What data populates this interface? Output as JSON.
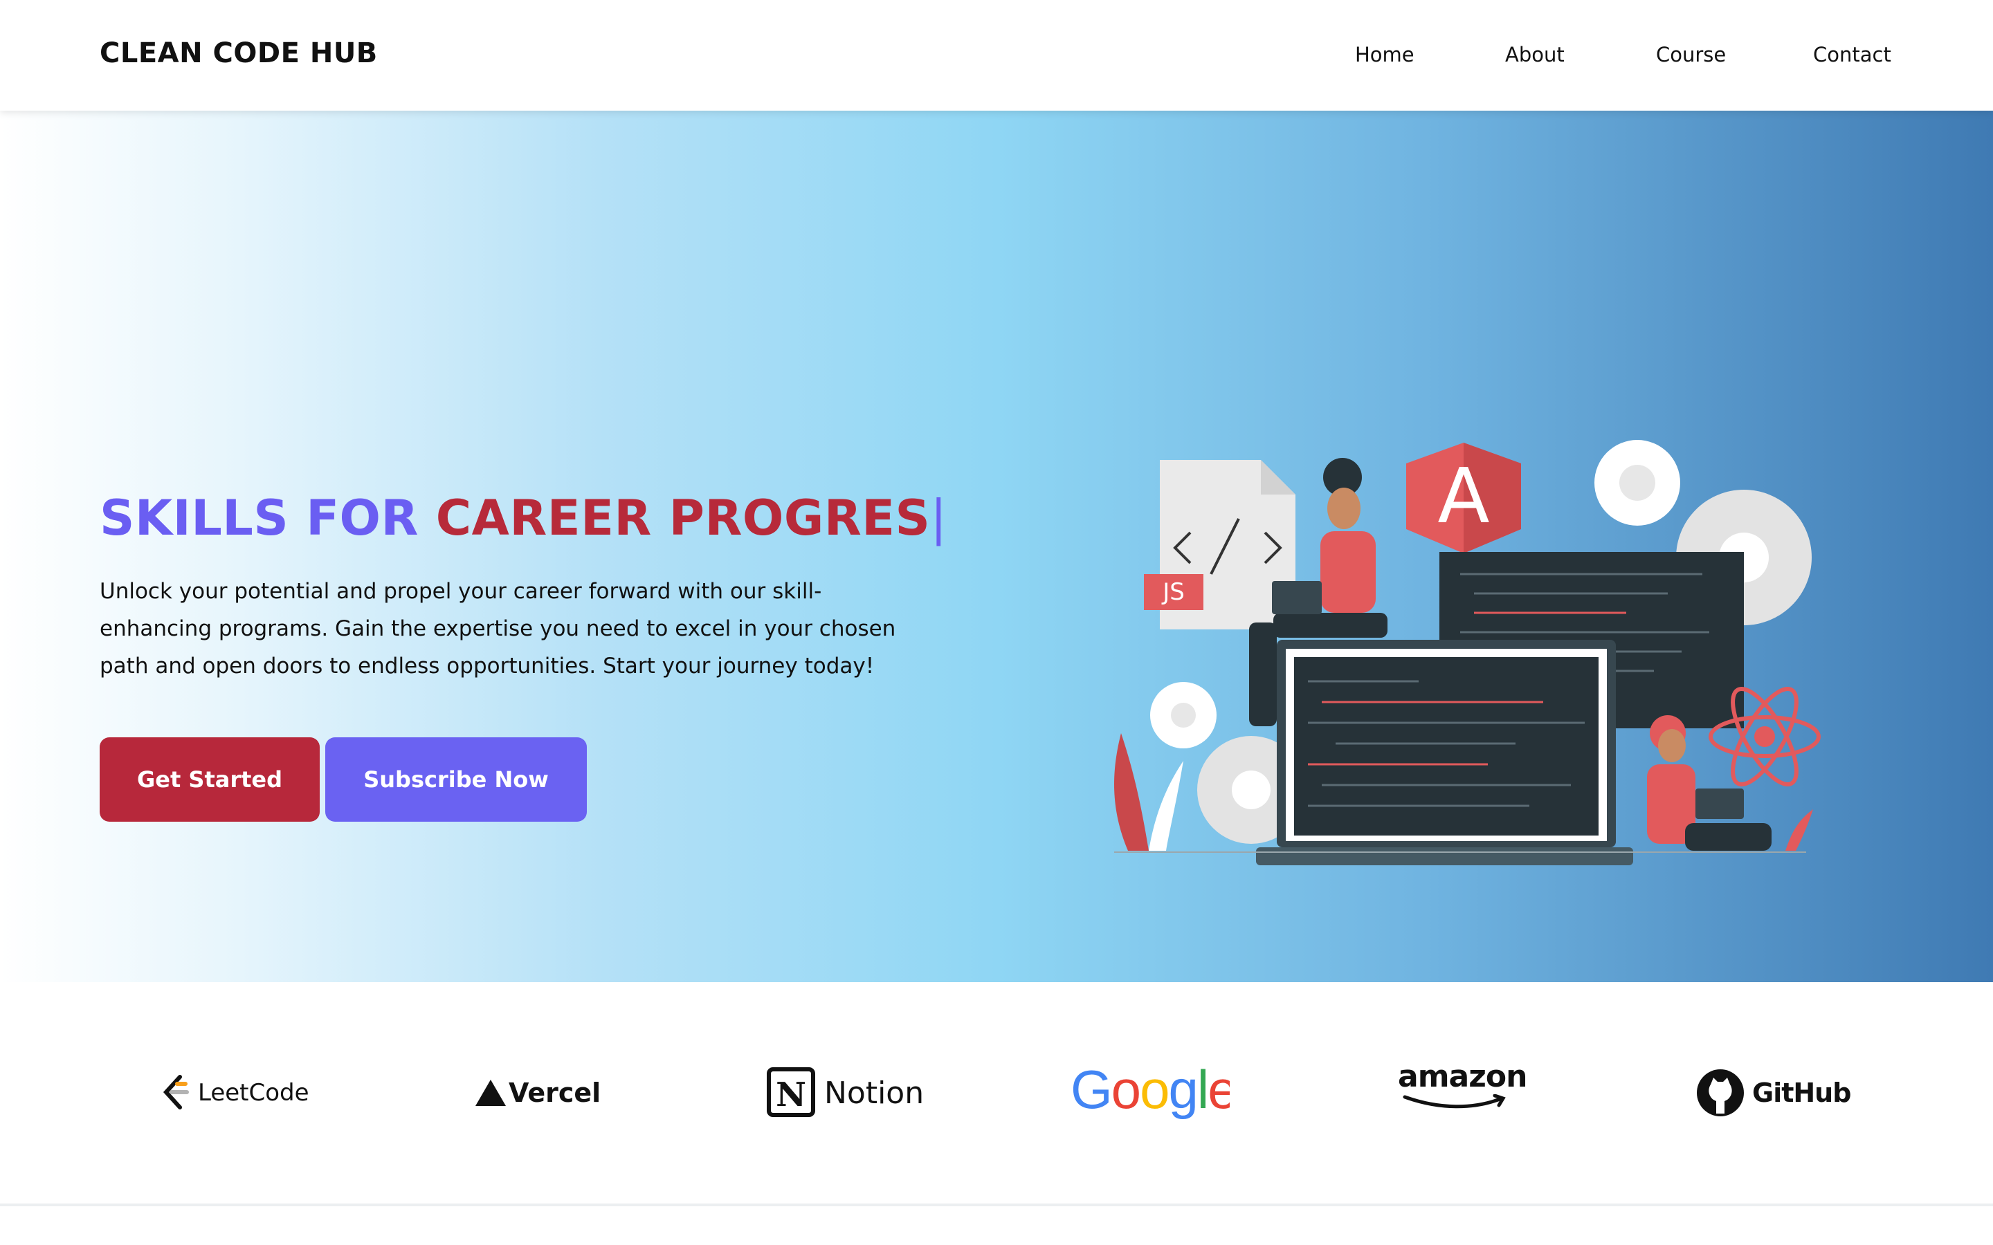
{
  "brand": {
    "name": "CLEAN CODE HUB"
  },
  "nav": {
    "items": [
      "Home",
      "About",
      "Course",
      "Contact"
    ]
  },
  "hero": {
    "headline_part1": "SKILLS FOR ",
    "headline_part2": "CAREER PROGRES",
    "cursor": "|",
    "paragraph_lines": [
      "Unlock your potential and propel your career forward with our skill-",
      "enhancing programs. Gain the expertise you need to excel in your chosen",
      "path and open doors to endless opportunities. Start your journey today!"
    ],
    "primary_button": "Get Started",
    "secondary_button": "Subscribe Now",
    "illustration": {
      "badge_js": "JS",
      "badge_angular": "A"
    }
  },
  "partners": {
    "logos": [
      {
        "name": "LeetCode",
        "icon": "leetcode-icon"
      },
      {
        "name": "Vercel",
        "icon": "vercel-triangle-icon"
      },
      {
        "name": "Notion",
        "icon": "notion-n-icon"
      },
      {
        "name": "Google",
        "icon": "google-wordmark"
      },
      {
        "name": "amazon",
        "icon": "amazon-smile-icon"
      },
      {
        "name": "GitHub",
        "icon": "github-octocat-icon"
      }
    ]
  },
  "colors": {
    "accent_purple": "#6a5ef2",
    "accent_red": "#b72a3a",
    "button_red": "#b7283b",
    "button_purple": "#6a62f2"
  }
}
